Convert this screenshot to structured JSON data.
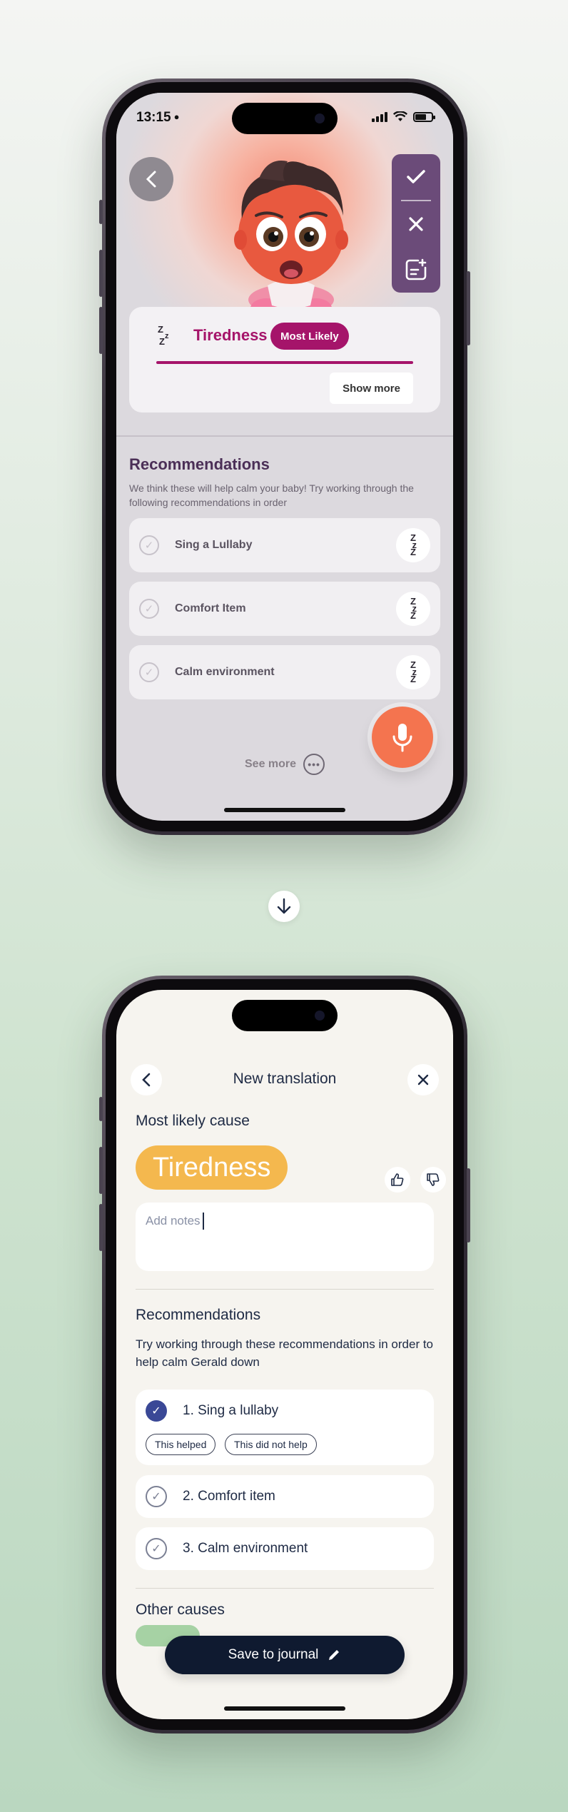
{
  "phone1": {
    "status": {
      "time": "13:15"
    },
    "cause": {
      "icon": "sleep-zz-icon",
      "name": "Tiredness",
      "badge": "Most Likely",
      "likelihood": 1.0,
      "show_more": "Show more"
    },
    "actions": [
      "check-icon",
      "close-icon",
      "add-note-icon"
    ],
    "recommendations": {
      "title": "Recommendations",
      "subtitle": "We think these will help calm your baby! Try working through the following recommendations in order",
      "items": [
        {
          "label": "Sing a Lullaby",
          "icon": "sleep-zz-icon"
        },
        {
          "label": "Comfort Item",
          "icon": "sleep-zz-icon"
        },
        {
          "label": "Calm environment",
          "icon": "sleep-zz-icon"
        }
      ],
      "see_more": "See more"
    },
    "colors": {
      "accent": "#a5146a",
      "fab": "#f4744f",
      "panel": "#6b4b79"
    }
  },
  "phone2": {
    "header": {
      "title": "New translation"
    },
    "most_likely_label": "Most likely cause",
    "cause": "Tiredness",
    "notes_placeholder": "Add notes",
    "recommendations": {
      "title": "Recommendations",
      "subtitle": "Try working through these recommendations in order to help calm Gerald down",
      "items": [
        {
          "label": "1. Sing a lullaby",
          "checked": true,
          "feedback": [
            "This helped",
            "This did not help"
          ]
        },
        {
          "label": "2. Comfort item",
          "checked": false
        },
        {
          "label": "3. Calm environment",
          "checked": false
        }
      ]
    },
    "other_causes_label": "Other causes",
    "save_button": "Save to journal",
    "colors": {
      "cause_pill": "#f4b84e",
      "primary": "#0f1a30",
      "check": "#3a4896"
    }
  }
}
